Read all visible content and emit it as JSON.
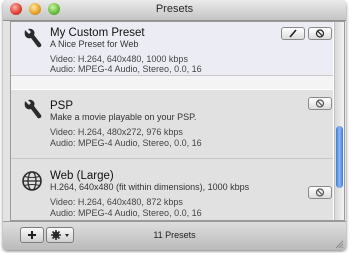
{
  "window": {
    "title": "Presets"
  },
  "presets": [
    {
      "name": "My Custom Preset",
      "subtitle": "A Nice Preset for Web",
      "video": "Video: H.264, 640x480, 1000 kbps",
      "audio": "Audio: MPEG-4 Audio, Stereo, 0.0, 16",
      "icon": "wrench-icon"
    },
    {
      "name": "PSP",
      "subtitle": "Make a movie playable on your PSP.",
      "video": "Video: H.264, 480x272, 976 kbps",
      "audio": "Audio: MPEG-4 Audio, Stereo, 0.0, 16",
      "icon": "wrench-icon"
    },
    {
      "name": "Web (Large)",
      "subtitle": "H.264, 640x480 (fit within dimensions), 1000 kbps",
      "video": "Video: H.264, 640x480, 872 kbps",
      "audio": "Audio: MPEG-4 Audio, Stereo, 0.0, 16",
      "icon": "globe-icon"
    }
  ],
  "footer": {
    "count_label": "11 Presets"
  },
  "colors": {
    "scroll_thumb": "#3c7ad6",
    "selected_row": "#ecedf4"
  }
}
